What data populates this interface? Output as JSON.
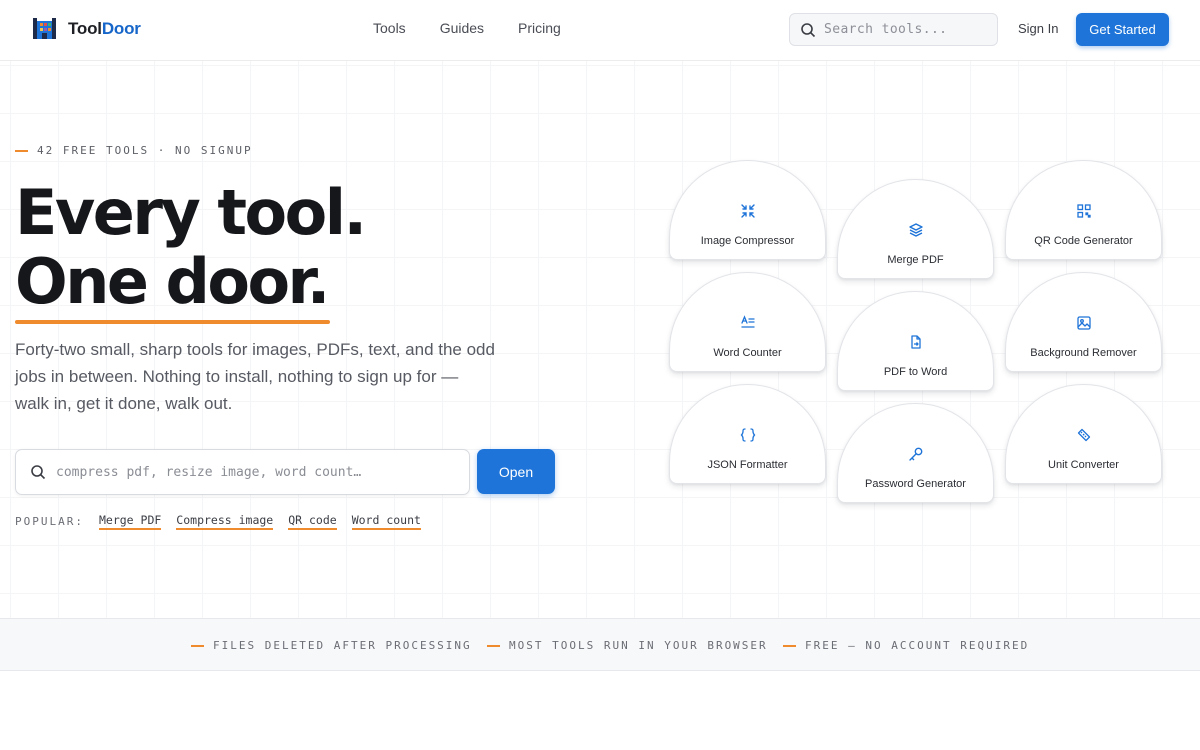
{
  "brand": {
    "name_part1": "Tool",
    "name_part2": "Door",
    "accent": "#1e74d8",
    "underline": "#ef8b2c"
  },
  "nav": {
    "items": [
      "Tools",
      "Guides",
      "Pricing"
    ]
  },
  "header_search": {
    "placeholder": "Search tools..."
  },
  "auth": {
    "signin_label": "Sign In",
    "cta_label": "Get Started"
  },
  "hero": {
    "eyebrow": "42 FREE TOOLS · NO SIGNUP",
    "headline_line1": "Every tool.",
    "headline_line2": "One door.",
    "lede": "Forty-two small, sharp tools for images, PDFs, text, and the odd jobs in between. Nothing to install, nothing to sign up for — walk in, get it done, walk out.",
    "search_placeholder": "compress pdf, resize image, word count…",
    "open_label": "Open",
    "popular_label": "POPULAR:",
    "popular_links": [
      "Merge PDF",
      "Compress image",
      "QR code",
      "Word count"
    ]
  },
  "tools": [
    {
      "label": "Image Compressor",
      "icon": "compress-icon"
    },
    {
      "label": "Merge PDF",
      "icon": "layers-icon"
    },
    {
      "label": "QR Code Generator",
      "icon": "qr-code-icon"
    },
    {
      "label": "Word Counter",
      "icon": "text-count-icon"
    },
    {
      "label": "PDF to Word",
      "icon": "file-convert-icon"
    },
    {
      "label": "Background Remover",
      "icon": "image-icon"
    },
    {
      "label": "JSON Formatter",
      "icon": "braces-icon"
    },
    {
      "label": "Password Generator",
      "icon": "key-icon"
    },
    {
      "label": "Unit Converter",
      "icon": "ruler-icon"
    }
  ],
  "trust": {
    "items": [
      "FILES DELETED AFTER PROCESSING",
      "MOST TOOLS RUN IN YOUR BROWSER",
      "FREE — NO ACCOUNT REQUIRED"
    ]
  }
}
